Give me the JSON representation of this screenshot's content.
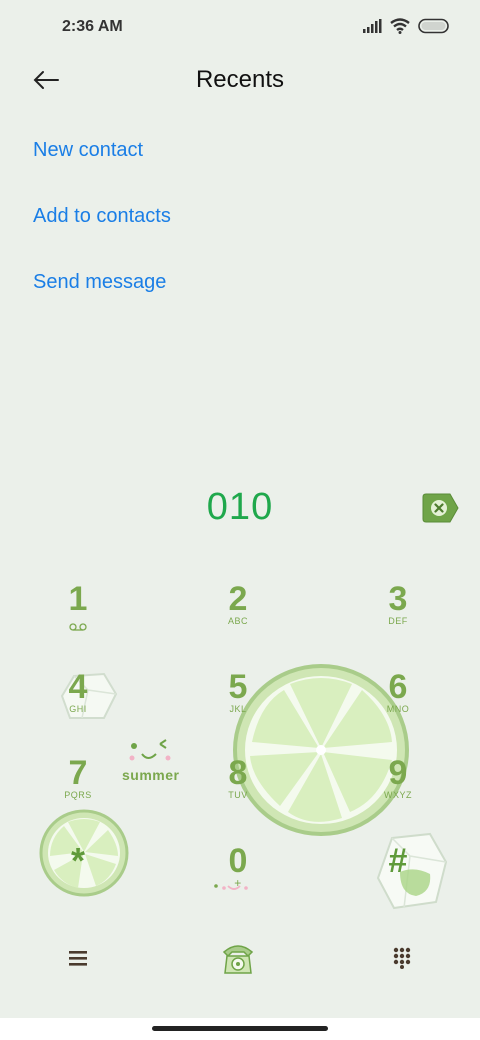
{
  "status": {
    "time": "2:36 AM"
  },
  "header": {
    "title": "Recents"
  },
  "menu": {
    "new_contact": "New contact",
    "add_to_contacts": "Add to contacts",
    "send_message": "Send message"
  },
  "dialer": {
    "number": "010"
  },
  "decor": {
    "summer_text": "summer"
  },
  "keypad": {
    "k1": {
      "digit": "1",
      "letters": ""
    },
    "k2": {
      "digit": "2",
      "letters": "ABC"
    },
    "k3": {
      "digit": "3",
      "letters": "DEF"
    },
    "k4": {
      "digit": "4",
      "letters": "GHI"
    },
    "k5": {
      "digit": "5",
      "letters": "JKL"
    },
    "k6": {
      "digit": "6",
      "letters": "MNO"
    },
    "k7": {
      "digit": "7",
      "letters": "PQRS"
    },
    "k8": {
      "digit": "8",
      "letters": "TUV"
    },
    "k9": {
      "digit": "9",
      "letters": "WXYZ"
    },
    "kstar": {
      "digit": "*",
      "letters": ""
    },
    "k0": {
      "digit": "0",
      "letters": "+"
    },
    "khash": {
      "digit": "#",
      "letters": ""
    }
  },
  "colors": {
    "link": "#1a7ee6",
    "number": "#1fa84c",
    "keypad": "#7ba84e",
    "background": "#ebf0ea"
  },
  "icons": [
    "back-arrow-icon",
    "signal-icon",
    "wifi-icon",
    "battery-icon",
    "delete-icon",
    "voicemail-icon",
    "menu-icon",
    "phone-call-icon",
    "dialpad-icon"
  ]
}
